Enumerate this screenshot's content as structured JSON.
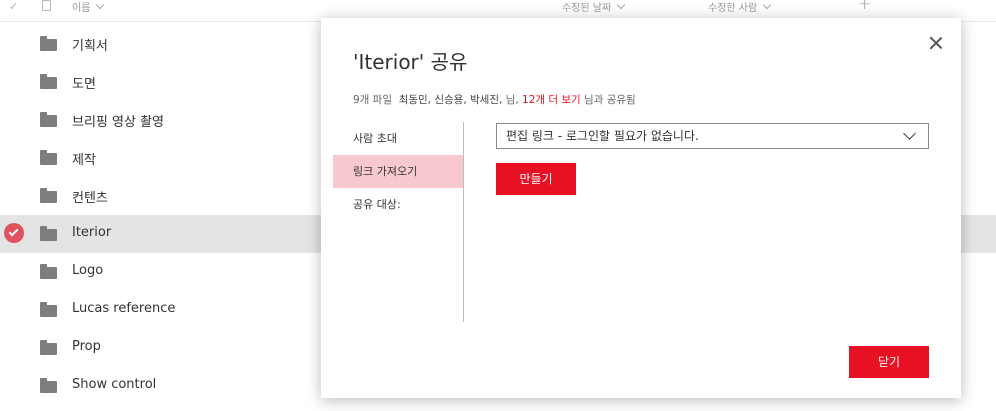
{
  "list": {
    "header": {
      "check_glyph": "✓",
      "name": "이름",
      "modified": "수정된 날짜",
      "modified_by": "수정한 사람",
      "add_glyph": "+"
    },
    "rows": [
      {
        "name": "기획서",
        "selected": false
      },
      {
        "name": "도면",
        "selected": false
      },
      {
        "name": "브리핑 영상 촬영",
        "selected": false
      },
      {
        "name": "제작",
        "selected": false
      },
      {
        "name": "컨텐츠",
        "selected": false
      },
      {
        "name": "Iterior",
        "selected": true
      },
      {
        "name": "Logo",
        "selected": false
      },
      {
        "name": "Lucas reference",
        "selected": false
      },
      {
        "name": "Prop",
        "selected": false
      },
      {
        "name": "Show control",
        "selected": false
      }
    ]
  },
  "dialog": {
    "title": "'Iterior' 공유",
    "shared": {
      "file_count": "9개 파일",
      "names": "최동민,  신승용,  박세진,",
      "suffix": "님,",
      "more_link": "12개 더 보기",
      "tail": "님과 공유됨"
    },
    "nav": {
      "invite": "사람 초대",
      "get_link": "링크 가져오기",
      "shared_with": "공유 대상:"
    },
    "link_type": "편집 링크 - 로그인할 필요가 없습니다.",
    "create_label": "만들기",
    "close_label": "닫기"
  },
  "colors": {
    "accent": "#e81123",
    "nav_active": "#f7c8cd",
    "selected_row": "#e4e4e4",
    "check_circle": "#e05260"
  },
  "icons": {
    "header_check": "check-icon",
    "header_file": "file-icon",
    "folder": "folder-icon",
    "selected_check": "check-circle-icon",
    "close": "close-icon",
    "dropdown": "chevron-down-icon"
  }
}
